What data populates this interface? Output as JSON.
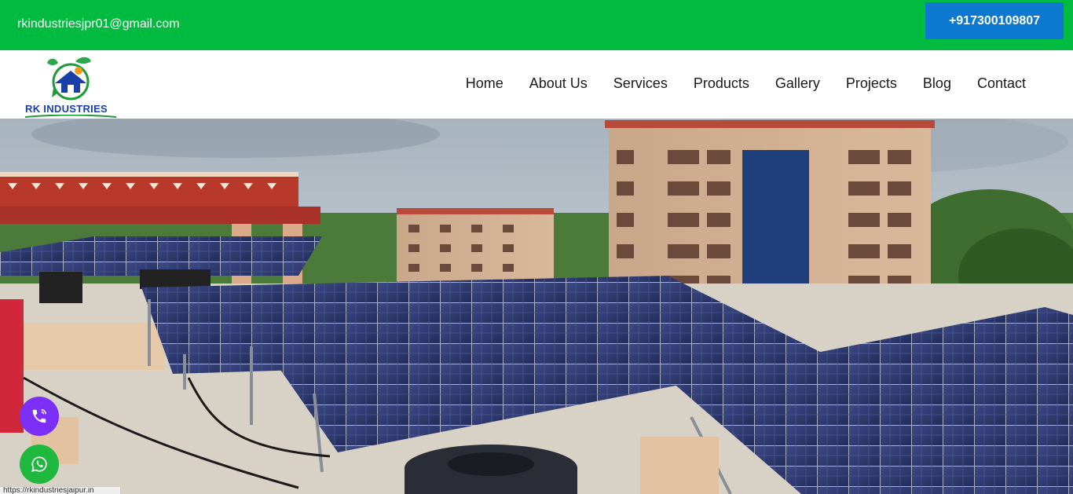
{
  "topbar": {
    "email": "rkindustriesjpr01@gmail.com",
    "phone": "+917300109807"
  },
  "brand": {
    "name": "RK INDUSTRIES"
  },
  "nav": {
    "items": [
      "Home",
      "About Us",
      "Services",
      "Products",
      "Gallery",
      "Projects",
      "Blog",
      "Contact"
    ]
  },
  "colors": {
    "topbar": "#00bb3f",
    "phone_button": "#0c78cf",
    "call_fab": "#7b2ff7",
    "whatsapp_fab": "#1fb83f"
  },
  "icons": {
    "call": "phone-call-icon",
    "whatsapp": "whatsapp-icon",
    "logo": "solar-house-leaf-logo"
  },
  "status": {
    "url": "https://rkindustriesjaipur.in"
  }
}
